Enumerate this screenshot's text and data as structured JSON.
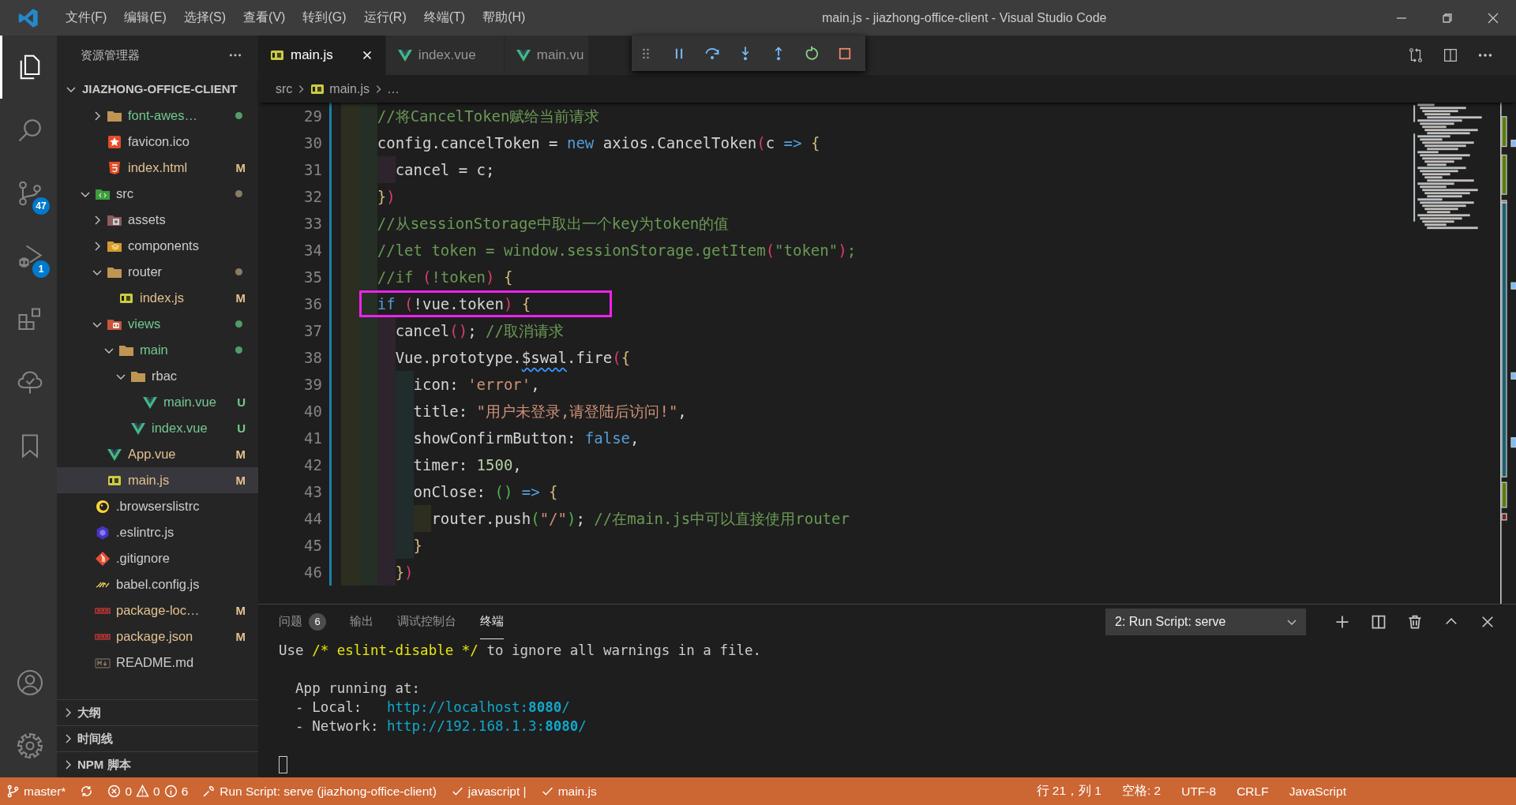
{
  "title_bar": {
    "menu": [
      "文件(F)",
      "编辑(E)",
      "选择(S)",
      "查看(V)",
      "转到(G)",
      "运行(R)",
      "终端(T)",
      "帮助(H)"
    ],
    "title": "main.js - jiazhong-office-client - Visual Studio Code"
  },
  "activity_bar": {
    "top": [
      {
        "kind": "explorer",
        "selected": true
      },
      {
        "kind": "search",
        "selected": false
      },
      {
        "kind": "source-control",
        "selected": false,
        "badge": "47"
      },
      {
        "kind": "run-debug",
        "selected": false,
        "badge": "1"
      },
      {
        "kind": "extensions",
        "selected": false
      },
      {
        "kind": "tree",
        "selected": false
      },
      {
        "kind": "bookmark",
        "selected": false
      }
    ],
    "bottom": [
      {
        "kind": "account"
      },
      {
        "kind": "settings"
      }
    ]
  },
  "explorer": {
    "title": "资源管理器",
    "root": {
      "label": "JIAZHONG-OFFICE-CLIENT",
      "expanded": true
    },
    "continued_items": [
      {
        "name": "font-awes…",
        "kind": "folder",
        "expanded": false,
        "untracked": true,
        "modified": false,
        "changed_inside": true,
        "selected": false
      },
      {
        "name": "favicon.ico",
        "kind": "favicon",
        "untracked": false,
        "modified": false,
        "selected": false
      },
      {
        "name": "index.html",
        "kind": "html",
        "untracked": false,
        "modified": true,
        "badge": "M",
        "selected": false
      }
    ],
    "items": [
      {
        "name": "src",
        "kind": "src-folder",
        "expanded": true,
        "untracked": false,
        "modified": false,
        "changed_inside": true,
        "selected": false,
        "children": [
          {
            "name": "assets",
            "kind": "assets-folder",
            "expanded": false,
            "untracked": false,
            "modified": false,
            "changed_inside": false,
            "selected": false
          },
          {
            "name": "components",
            "kind": "components-folder",
            "expanded": false,
            "untracked": false,
            "modified": false,
            "changed_inside": false,
            "selected": false
          },
          {
            "name": "router",
            "kind": "folder",
            "expanded": true,
            "untracked": false,
            "modified": false,
            "changed_inside": true,
            "selected": false,
            "children": [
              {
                "name": "index.js",
                "kind": "js",
                "untracked": false,
                "modified": true,
                "badge": "M",
                "selected": false
              }
            ]
          },
          {
            "name": "views",
            "kind": "views-folder",
            "expanded": true,
            "untracked": true,
            "modified": false,
            "changed_inside": true,
            "selected": false,
            "children": [
              {
                "name": "main",
                "kind": "folder",
                "expanded": true,
                "untracked": true,
                "modified": false,
                "changed_inside": true,
                "selected": false,
                "children": [
                  {
                    "name": "rbac",
                    "kind": "folder",
                    "expanded": true,
                    "untracked": false,
                    "modified": false,
                    "changed_inside": false,
                    "selected": false,
                    "children": [
                      {
                        "name": "main.vue",
                        "kind": "vue",
                        "untracked": true,
                        "modified": false,
                        "badge": "U",
                        "selected": false
                      }
                    ]
                  },
                  {
                    "name": "index.vue",
                    "kind": "vue",
                    "untracked": true,
                    "modified": false,
                    "badge": "U",
                    "selected": false
                  }
                ]
              }
            ]
          },
          {
            "name": "App.vue",
            "kind": "vue",
            "untracked": false,
            "modified": true,
            "badge": "M",
            "selected": false
          },
          {
            "name": "main.js",
            "kind": "js",
            "untracked": false,
            "modified": true,
            "badge": "M",
            "selected": true
          }
        ]
      },
      {
        "name": ".browserslistrc",
        "kind": "browserslist",
        "untracked": false,
        "modified": false,
        "selected": false
      },
      {
        "name": ".eslintrc.js",
        "kind": "eslint",
        "untracked": false,
        "modified": false,
        "selected": false
      },
      {
        "name": ".gitignore",
        "kind": "gitignore",
        "untracked": false,
        "modified": false,
        "selected": false
      },
      {
        "name": "babel.config.js",
        "kind": "babel",
        "untracked": false,
        "modified": false,
        "selected": false
      },
      {
        "name": "package-loc…",
        "kind": "npm",
        "untracked": false,
        "modified": true,
        "badge": "M",
        "selected": false
      },
      {
        "name": "package.json",
        "kind": "npm",
        "untracked": false,
        "modified": true,
        "badge": "M",
        "selected": false
      },
      {
        "name": "README.md",
        "kind": "markdown",
        "untracked": false,
        "modified": false,
        "selected": false
      }
    ],
    "sections": [
      {
        "label": "大纲",
        "expanded": false
      },
      {
        "label": "时间线",
        "expanded": false
      },
      {
        "label": "NPM 脚本",
        "expanded": false
      }
    ]
  },
  "editor": {
    "tabs": [
      {
        "label": "main.js",
        "kind": "js",
        "selected": true
      },
      {
        "label": "index.vue",
        "kind": "vue",
        "selected": false
      },
      {
        "label": "main.vu",
        "kind": "vue",
        "selected": false
      }
    ],
    "breadcrumb": [
      {
        "label": "src",
        "kind": "folder"
      },
      {
        "label": "main.js",
        "kind": "js"
      },
      {
        "label": "…",
        "kind": "more"
      }
    ],
    "lines": [
      {
        "number": "29",
        "tokens": [
          {
            "kind": "comment",
            "text": "    //将CancelToken赋给当前请求"
          }
        ]
      },
      {
        "number": "30",
        "tokens": [
          {
            "kind": "plain",
            "text": "    config.cancelToken = "
          },
          {
            "kind": "keyword",
            "text": "new"
          },
          {
            "kind": "plain",
            "text": " axios.CancelToken"
          },
          {
            "kind": "bracket1",
            "text": "("
          },
          {
            "kind": "plain",
            "text": "c "
          },
          {
            "kind": "keyword",
            "text": "=>"
          },
          {
            "kind": "bracket2",
            "text": " {"
          }
        ]
      },
      {
        "number": "31",
        "tokens": [
          {
            "kind": "plain",
            "text": "      cancel = c;"
          }
        ]
      },
      {
        "number": "32",
        "tokens": [
          {
            "kind": "bracket2",
            "text": "    }"
          },
          {
            "kind": "bracket1",
            "text": ")"
          }
        ]
      },
      {
        "number": "33",
        "tokens": [
          {
            "kind": "comment",
            "text": "    //从sessionStorage中取出一个key为token的值"
          }
        ]
      },
      {
        "number": "34",
        "tokens": [
          {
            "kind": "comment",
            "text": "    //let token = window.sessionStorage.getItem"
          },
          {
            "kind": "bracket1",
            "text": "("
          },
          {
            "kind": "comment",
            "text": "\"token\""
          },
          {
            "kind": "bracket1",
            "text": ")"
          },
          {
            "kind": "comment",
            "text": ";"
          }
        ]
      },
      {
        "number": "35",
        "tokens": [
          {
            "kind": "comment",
            "text": "    //if "
          },
          {
            "kind": "bracket1",
            "text": "("
          },
          {
            "kind": "comment",
            "text": "!token"
          },
          {
            "kind": "bracket1",
            "text": ")"
          },
          {
            "kind": "bracket2",
            "text": " {"
          }
        ]
      },
      {
        "number": "36",
        "boxed": true,
        "tokens": [
          {
            "kind": "keyword",
            "text": "    if"
          },
          {
            "kind": "bracket1",
            "text": " ("
          },
          {
            "kind": "plain",
            "text": "!vue.token"
          },
          {
            "kind": "bracket1",
            "text": ")"
          },
          {
            "kind": "bracket2",
            "text": " {"
          }
        ]
      },
      {
        "number": "37",
        "tokens": [
          {
            "kind": "plain",
            "text": "      cancel"
          },
          {
            "kind": "bracket1",
            "text": "()"
          },
          {
            "kind": "plain",
            "text": "; "
          },
          {
            "kind": "comment",
            "text": "//取消请求"
          }
        ]
      },
      {
        "number": "38",
        "tokens": [
          {
            "kind": "plain",
            "text": "      Vue.prototype."
          },
          {
            "kind": "plain",
            "text": "$swal",
            "warning": true
          },
          {
            "kind": "plain",
            "text": ".fire"
          },
          {
            "kind": "bracket1",
            "text": "("
          },
          {
            "kind": "bracket2",
            "text": "{"
          }
        ]
      },
      {
        "number": "39",
        "tokens": [
          {
            "kind": "plain",
            "text": "        icon: "
          },
          {
            "kind": "string",
            "text": "'error'"
          },
          {
            "kind": "plain",
            "text": ","
          }
        ]
      },
      {
        "number": "40",
        "tokens": [
          {
            "kind": "plain",
            "text": "        title: "
          },
          {
            "kind": "string",
            "text": "\"用户未登录,请登陆后访问!\""
          },
          {
            "kind": "plain",
            "text": ","
          }
        ]
      },
      {
        "number": "41",
        "tokens": [
          {
            "kind": "plain",
            "text": "        showConfirmButton: "
          },
          {
            "kind": "keyword",
            "text": "false"
          },
          {
            "kind": "plain",
            "text": ","
          }
        ]
      },
      {
        "number": "42",
        "tokens": [
          {
            "kind": "plain",
            "text": "        timer: "
          },
          {
            "kind": "number",
            "text": "1500"
          },
          {
            "kind": "plain",
            "text": ","
          }
        ]
      },
      {
        "number": "43",
        "tokens": [
          {
            "kind": "plain",
            "text": "        onClose: "
          },
          {
            "kind": "bracket3",
            "text": "()"
          },
          {
            "kind": "keyword",
            "text": " =>"
          },
          {
            "kind": "bracket2",
            "text": " {"
          }
        ]
      },
      {
        "number": "44",
        "tokens": [
          {
            "kind": "plain",
            "text": "          router.push"
          },
          {
            "kind": "bracket3",
            "text": "("
          },
          {
            "kind": "string",
            "text": "\"/\""
          },
          {
            "kind": "bracket3",
            "text": ")"
          },
          {
            "kind": "plain",
            "text": "; "
          },
          {
            "kind": "comment",
            "text": "//在main.js中可以直接使用router"
          }
        ]
      },
      {
        "number": "45",
        "tokens": [
          {
            "kind": "bracket2",
            "text": "        }"
          }
        ]
      },
      {
        "number": "46",
        "tokens": [
          {
            "kind": "bracket2",
            "text": "      }"
          },
          {
            "kind": "bracket1",
            "text": ")"
          }
        ]
      }
    ]
  },
  "panel": {
    "tabs": [
      {
        "label": "问题",
        "badge": "6",
        "selected": false
      },
      {
        "label": "输出",
        "selected": false
      },
      {
        "label": "调试控制台",
        "selected": false
      },
      {
        "label": "终端",
        "selected": true
      }
    ],
    "terminal_select": "2: Run Script: serve",
    "terminal": [
      {
        "kind": "output",
        "segments": [
          {
            "kind": "text",
            "text": "Use "
          },
          {
            "kind": "highlight",
            "text": "/* eslint-disable */"
          },
          {
            "kind": "text",
            "text": " to ignore all warnings in a file."
          }
        ]
      },
      {
        "kind": "blank"
      },
      {
        "kind": "output",
        "segments": [
          {
            "kind": "text",
            "text": "  App running at:"
          }
        ]
      },
      {
        "kind": "output",
        "segments": [
          {
            "kind": "text",
            "text": "  - Local:   "
          },
          {
            "kind": "link",
            "text": "http://localhost:**8080**/"
          }
        ]
      },
      {
        "kind": "output",
        "segments": [
          {
            "kind": "text",
            "text": "  - Network: "
          },
          {
            "kind": "link",
            "text": "http://192.168.1.3:**8080**/"
          }
        ]
      },
      {
        "kind": "blank"
      },
      {
        "kind": "cursor"
      }
    ]
  },
  "status_bar": {
    "left": [
      {
        "kind": "branch",
        "text": "master*"
      },
      {
        "kind": "sync"
      },
      {
        "kind": "problems",
        "errors": "0",
        "warnings": "0",
        "infos": "6"
      },
      {
        "kind": "task",
        "text": "Run Script: serve (jiazhong-office-client)"
      },
      {
        "kind": "check",
        "text": "javascript |"
      },
      {
        "kind": "check",
        "text": "main.js"
      }
    ],
    "right": [
      {
        "kind": "text",
        "text": "行 21，列 1"
      },
      {
        "kind": "text",
        "text": "空格: 2"
      },
      {
        "kind": "text",
        "text": "UTF-8"
      },
      {
        "kind": "text",
        "text": "CRLF"
      },
      {
        "kind": "text",
        "text": "JavaScript"
      }
    ]
  }
}
